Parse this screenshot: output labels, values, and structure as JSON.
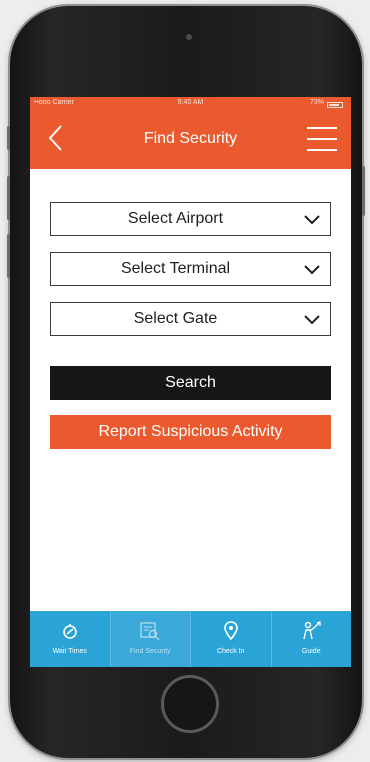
{
  "status_bar": {
    "carrier": "••ooo Carrier",
    "time": "9:40 AM",
    "battery": "73%"
  },
  "header": {
    "title": "Find Security",
    "back_icon": "chevron-left-icon",
    "menu_icon": "hamburger-menu-icon"
  },
  "form": {
    "airport_select": "Select Airport",
    "terminal_select": "Select Terminal",
    "gate_select": "Select Gate",
    "search_button": "Search",
    "report_button": "Report Suspicious Activity"
  },
  "tabs": [
    {
      "label": "Wait Times",
      "icon": "stopwatch-icon",
      "active": false
    },
    {
      "label": "Find Security",
      "icon": "security-scanner-icon",
      "active": true
    },
    {
      "label": "Check In",
      "icon": "location-pin-icon",
      "active": false
    },
    {
      "label": "Guide",
      "icon": "guide-person-icon",
      "active": false
    }
  ],
  "colors": {
    "accent": "#ea5a2e",
    "tabbar": "#2aa3d6",
    "search_button": "#161616"
  }
}
